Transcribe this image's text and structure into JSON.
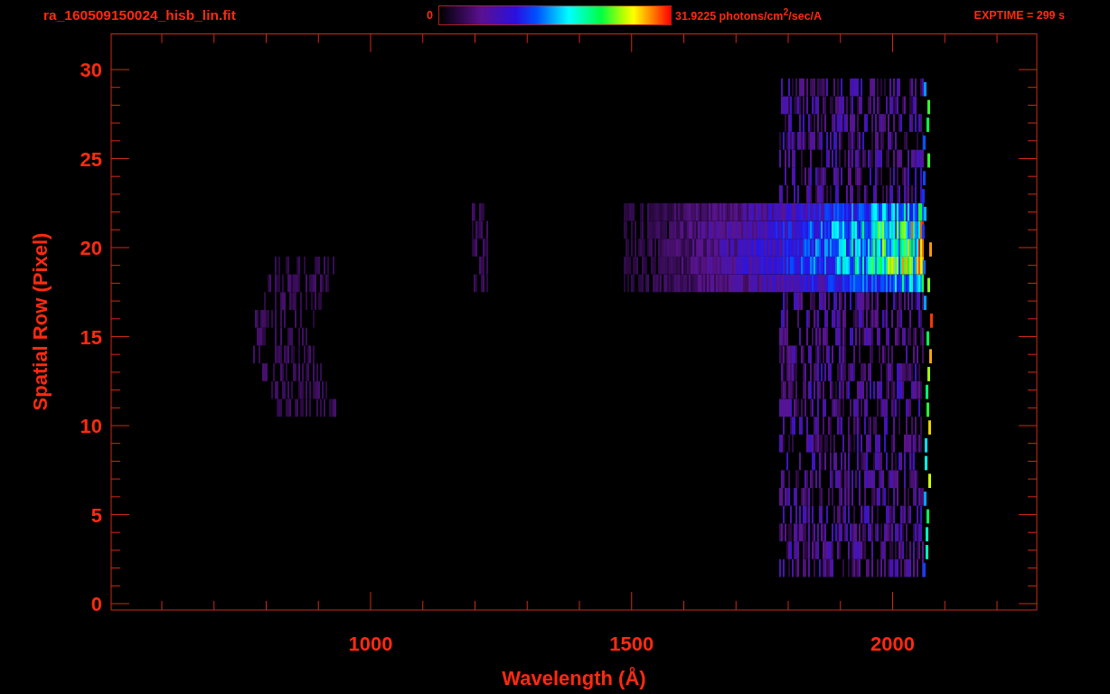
{
  "header": {
    "file_name": "ra_160509150024_hisb_lin.fit",
    "colorbar_min": "0",
    "colorbar_max_units": "31.9225 photons/cm$^{2}$/sec/A",
    "exposure": "EXPTIME = 299 s"
  },
  "plot": {
    "y_axis": {
      "label": "Spatial Row (Pixel)",
      "ticks": [
        "30",
        "25",
        "20",
        "15",
        "10",
        "5",
        "0"
      ]
    },
    "x_axis": {
      "label": "Wavelength (Å)",
      "ticks": [
        "1000",
        "1500",
        "2000"
      ]
    }
  }
}
